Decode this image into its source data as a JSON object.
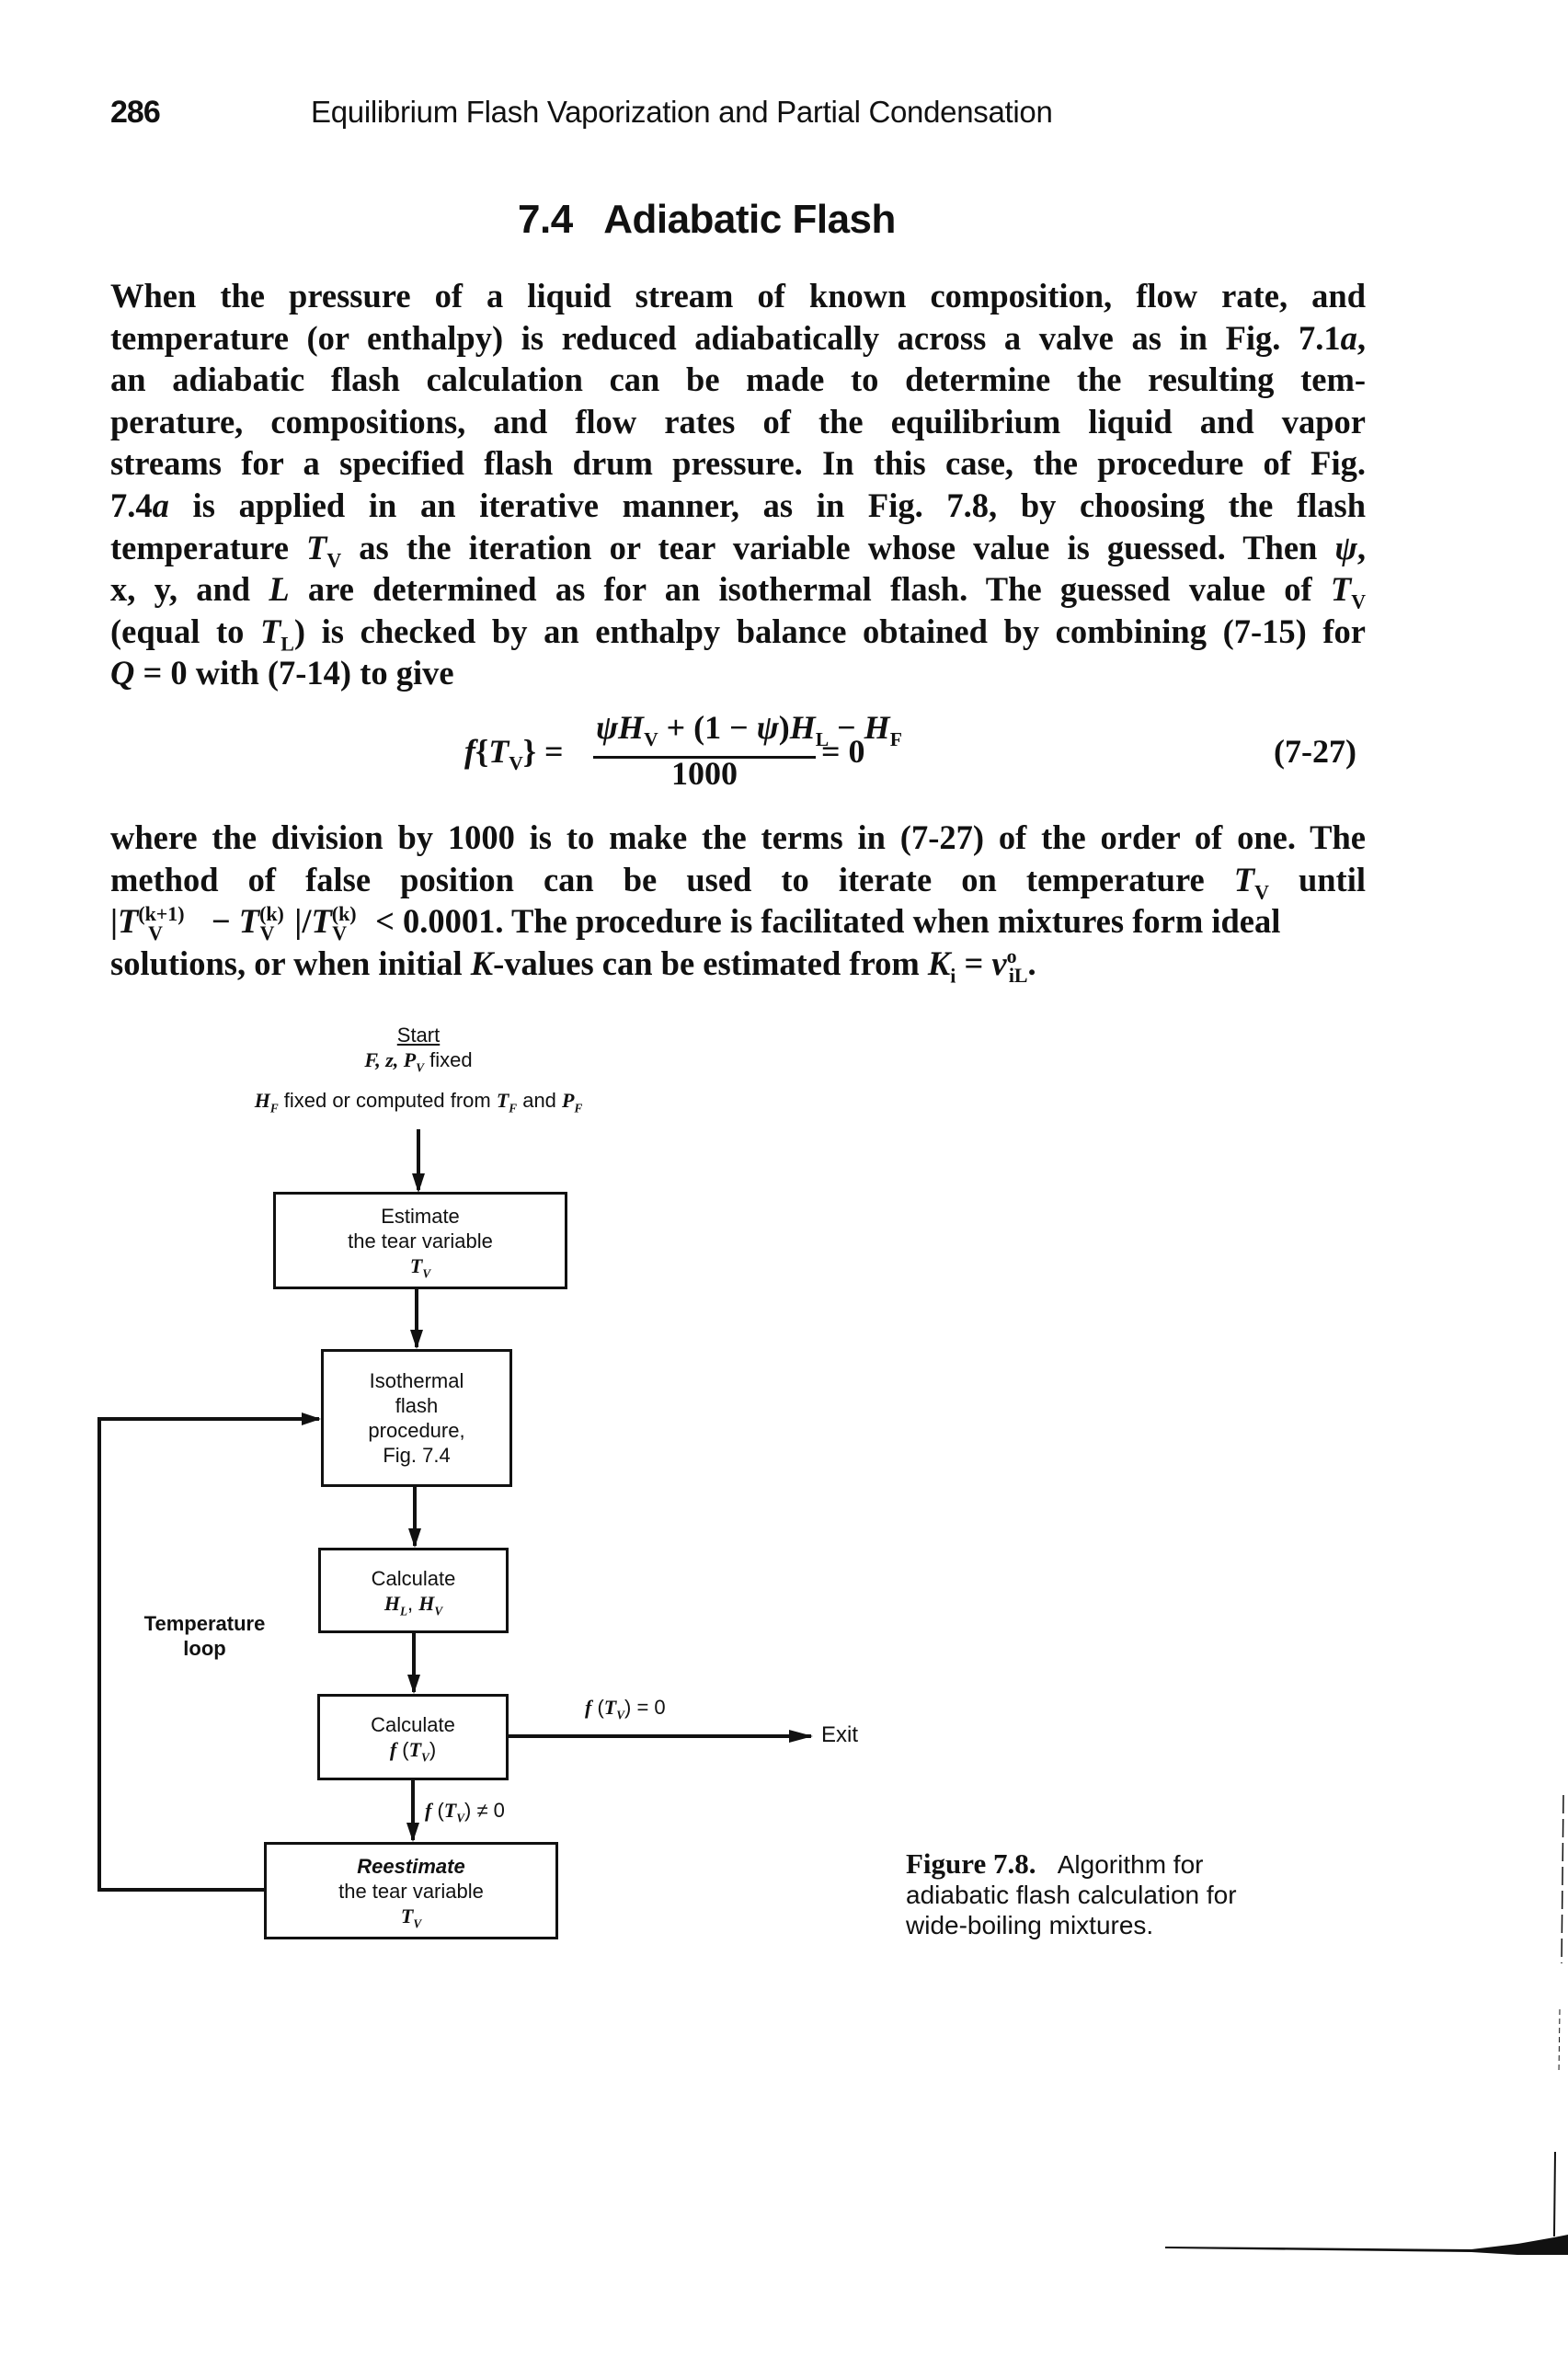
{
  "header": {
    "page_number": "286",
    "running_head": "Equilibrium Flash Vaporization and Partial Condensation"
  },
  "section": {
    "number": "7.4",
    "title": "Adiabatic Flash",
    "full_title": "7.4   Adiabatic Flash"
  },
  "paragraph1": {
    "lines": [
      [
        "When the pressure of a liquid stream of known composition, flow rate, and"
      ],
      [
        "temperature (or enthalpy) is reduced adiabatically across a valve as in Fig. 7.1",
        "a",
        ","
      ],
      [
        "an adiabatic flash calculation can be made to determine the resulting tem-"
      ],
      [
        "perature, compositions, and flow rates of the equilibrium liquid and vapor"
      ],
      [
        "streams for a specified flash drum pressure. In this case, the procedure of Fig."
      ],
      [
        "7.4",
        "a",
        " is applied in an iterative manner, as in Fig. 7.8, by choosing the flash"
      ],
      [
        "temperature ",
        "T",
        "V",
        " as the iteration or tear variable whose value is guessed. Then ",
        "ψ",
        ","
      ],
      [
        "x, y, and ",
        "L",
        " are determined as for an isothermal flash. The guessed value of ",
        "T",
        "V"
      ],
      [
        "(equal to ",
        "T",
        "L",
        ") is checked by an enthalpy balance obtained by combining (7-15) for"
      ],
      [
        "Q",
        " = 0 with (7-14) to give"
      ]
    ]
  },
  "equation": {
    "lhs_f": "f",
    "lhs_T": "T",
    "lhs_sub": "V",
    "numerator": {
      "psi1": "ψ",
      "H1": "H",
      "H1_sub": "V",
      "mid": " + (1 − ",
      "psi2": "ψ",
      "close": ")",
      "H2": "H",
      "H2_sub": "L",
      "minus": " − ",
      "H3": "H",
      "H3_sub": "F"
    },
    "denominator": "1000",
    "rhs": "= 0",
    "number": "(7-27)"
  },
  "paragraph2": {
    "line1": "where the division by 1000 is to make the terms in (7-27) of the order of one. The",
    "line2_a": "method of false position can be used to iterate on temperature ",
    "line2_T": "T",
    "line2_sub": "V",
    "line2_b": " until",
    "line3_bar": "|",
    "line3_T1": "T",
    "line3_sup1": "(k+1)",
    "line3_sub1": "V",
    "line3_minus": " − ",
    "line3_T2": "T",
    "line3_sup2": "(k)",
    "line3_sub2": "V",
    "line3_sep": "|/",
    "line3_T3": "T",
    "line3_sup3": "(k)",
    "line3_sub3": "V",
    "line3_rest": " < 0.0001. The procedure is facilitated when mixtures form ideal",
    "line4_a": "solutions, or when initial ",
    "line4_K": "K",
    "line4_b": "-values can be estimated from ",
    "line4_Ki": "K",
    "line4_i": "i",
    "line4_eq": " = ",
    "line4_nu": "ν",
    "line4_sup": "o",
    "line4_sub": "iL",
    "line4_end": "."
  },
  "flowchart": {
    "start": {
      "label": "Start",
      "line2_vars": "F, z, P",
      "line2_sub": "V",
      "line2_text": " fixed",
      "line3_H": "H",
      "line3_Hsub": "F",
      "line3_text1": " fixed or computed from ",
      "line3_T": "T",
      "line3_Tsub": "F",
      "line3_text2": " and ",
      "line3_P": "P",
      "line3_Psub": "F"
    },
    "nodes": [
      {
        "id": "estimate",
        "line1": "Estimate",
        "line2": "the tear variable",
        "var": "T",
        "var_sub": "V"
      },
      {
        "id": "isothermal",
        "line1": "Isothermal",
        "line2": "flash",
        "line3": "procedure,",
        "line4": "Fig. 7.4"
      },
      {
        "id": "calc-h",
        "line1": "Calculate",
        "var1": "H",
        "var1_sub": "L",
        "sep": ", ",
        "var2": "H",
        "var2_sub": "V"
      },
      {
        "id": "calc-f",
        "line1": "Calculate",
        "fn": "f",
        "var": "T",
        "var_sub": "V"
      },
      {
        "id": "reestimate",
        "line1": "Reestimate",
        "line2": "the tear variable",
        "var": "T",
        "var_sub": "V"
      }
    ],
    "loop_label_line1": "Temperature",
    "loop_label_line2": "loop",
    "exit_condition": {
      "fn": "f",
      "var": "T",
      "var_sub": "V",
      "rel": " = 0"
    },
    "continue_condition": {
      "fn": "f",
      "var": "T",
      "var_sub": "V",
      "rel": " ≠ 0"
    },
    "exit_label": "Exit"
  },
  "caption": {
    "title": "Figure 7.8.",
    "line1": "Algorithm for",
    "line2": "adiabatic flash calculation for",
    "line3": "wide-boiling mixtures."
  }
}
